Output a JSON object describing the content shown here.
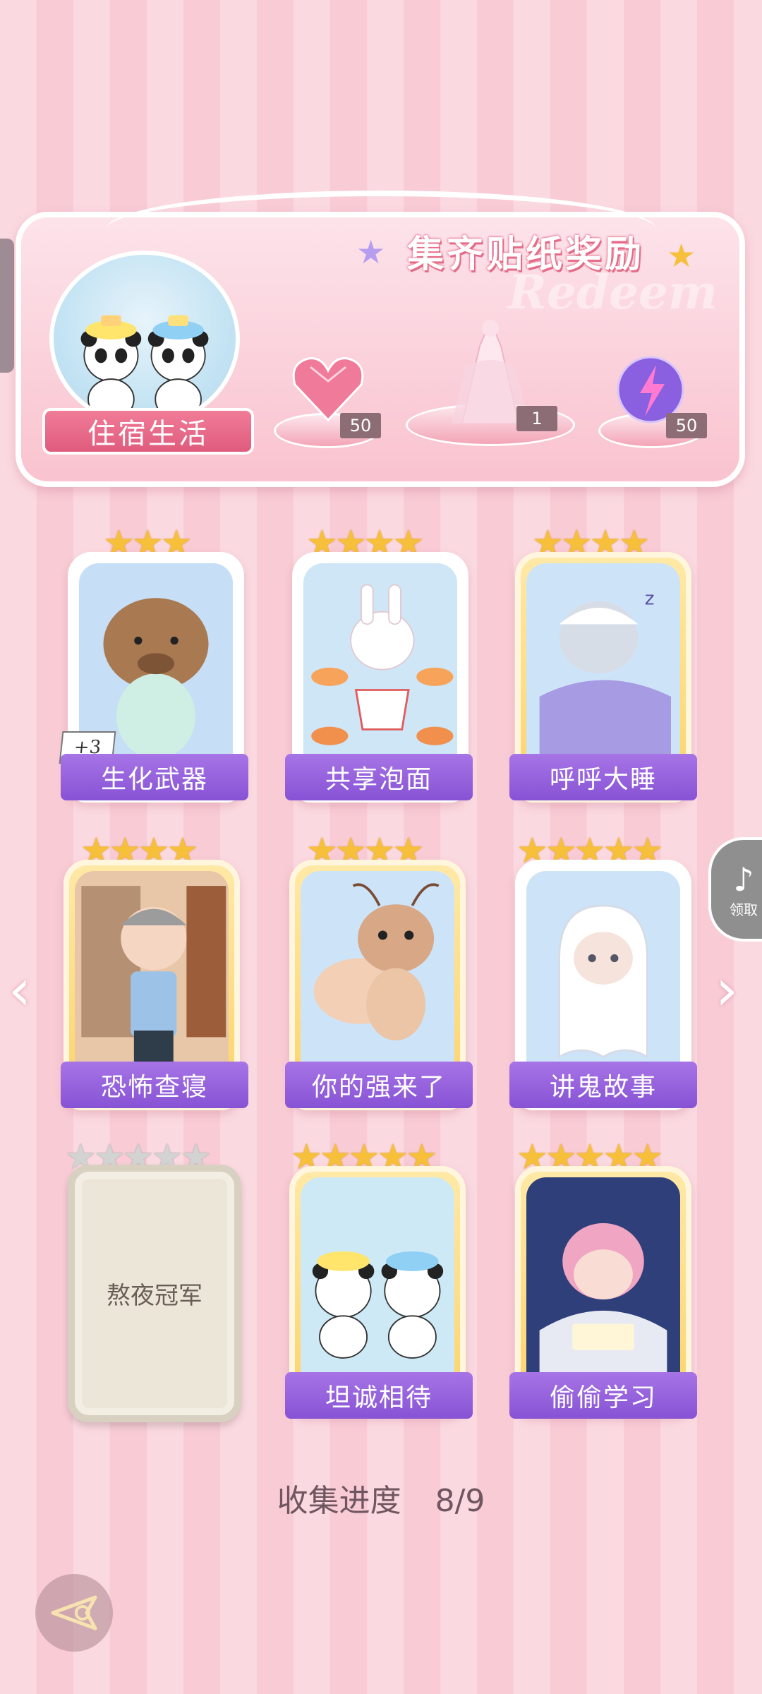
{
  "banner": {
    "title": "集齐贴纸奖励",
    "watermark": "Redeem",
    "theme_label": "住宿生活",
    "rewards": [
      {
        "name": "heart-gem",
        "count": "50"
      },
      {
        "name": "dress-outfit",
        "count": "1"
      },
      {
        "name": "energy-orb",
        "count": "50"
      }
    ]
  },
  "stickers": [
    {
      "label": "生化武器",
      "stars": 3,
      "frame": "white",
      "badge": "+3"
    },
    {
      "label": "共享泡面",
      "stars": 4,
      "frame": "white"
    },
    {
      "label": "呼呼大睡",
      "stars": 4,
      "frame": "gold"
    },
    {
      "label": "恐怖查寝",
      "stars": 4,
      "frame": "gold"
    },
    {
      "label": "你的强来了",
      "stars": 4,
      "frame": "gold"
    },
    {
      "label": "讲鬼故事",
      "stars": 5,
      "frame": "white"
    },
    {
      "label": "熬夜冠军",
      "stars": 5,
      "frame": "locked"
    },
    {
      "label": "坦诚相待",
      "stars": 5,
      "frame": "gold"
    },
    {
      "label": "偷偷学习",
      "stars": 5,
      "frame": "gold"
    }
  ],
  "progress": {
    "label": "收集进度",
    "value": "8/9",
    "collected": 8,
    "total": 9
  },
  "float_button": {
    "label": "领取"
  },
  "colors": {
    "accent_purple": "#8753d5",
    "star_gold": "#f6c03a",
    "banner_pink": "#f07c98"
  },
  "icons": [
    "chevron-left-icon",
    "chevron-right-icon",
    "back-arrow-icon",
    "star-icon",
    "sparkle-icon"
  ]
}
